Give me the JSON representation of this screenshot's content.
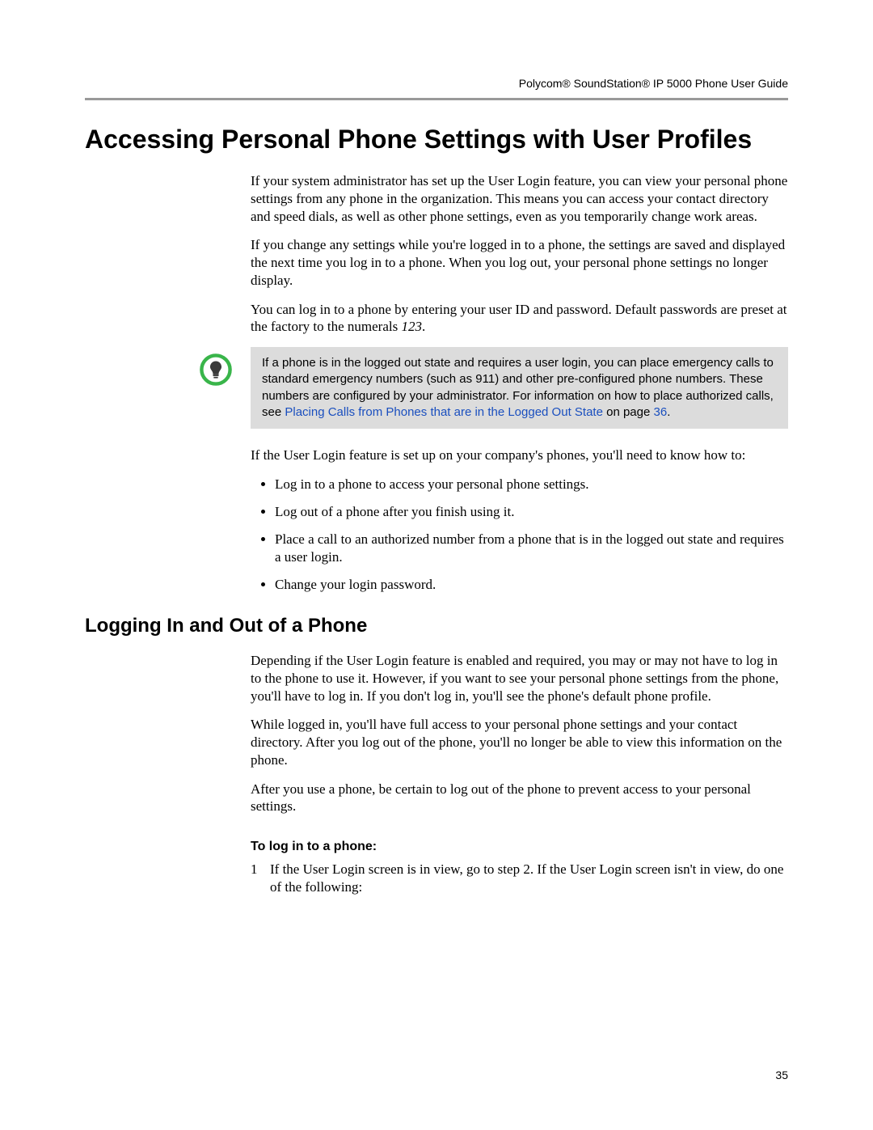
{
  "header": {
    "product_left": "Polycom® SoundStation® IP 5000 Phone User Guide"
  },
  "h1": "Accessing Personal Phone Settings with User Profiles",
  "p1": "If your system administrator has set up the User Login feature, you can view your personal phone settings from any phone in the organization. This means you can access your contact directory and speed dials, as well as other phone settings, even as you temporarily change work areas.",
  "p2": "If you change any settings while you're logged in to a phone, the settings are saved and displayed the next time you log in to a phone. When you log out, your personal phone settings no longer display.",
  "p3_a": "You can log in to a phone by entering your user ID and password. Default passwords are preset at the factory to the numerals ",
  "p3_b": "123",
  "p3_c": ".",
  "note": {
    "t1": "If a phone is in the logged out state and requires a user login, you can place emergency calls to standard emergency numbers (such as 911) and other pre-configured phone numbers. These numbers are configured by your administrator. For information on how to place authorized calls, see ",
    "link": "Placing Calls from Phones that are in the Logged Out State",
    "t2": " on page ",
    "pg": "36",
    "t3": "."
  },
  "p4": "If the User Login feature is set up on your company's phones, you'll need to know how to:",
  "bullets": [
    "Log in to a phone to access your personal phone settings.",
    "Log out of a phone after you finish using it.",
    "Place a call to an authorized number from a phone that is in the logged out state and requires a user login.",
    "Change your login password."
  ],
  "h2": "Logging In and Out of a Phone",
  "p5": "Depending if the User Login feature is enabled and required, you may or may not have to log in to the phone to use it. However, if you want to see your personal phone settings from the phone, you'll have to log in. If you don't log in, you'll see the phone's default phone profile.",
  "p6": "While logged in, you'll have full access to your personal phone settings and your contact directory. After you log out of the phone, you'll no longer be able to view this information on the phone.",
  "p7": "After you use a phone, be certain to log out of the phone to prevent access to your personal settings.",
  "h3": "To log in to a phone:",
  "step1_num": "1",
  "step1": "If the User Login screen is in view, go to step 2. If the User Login screen isn't in view, do one of the following:",
  "page_number": "35"
}
